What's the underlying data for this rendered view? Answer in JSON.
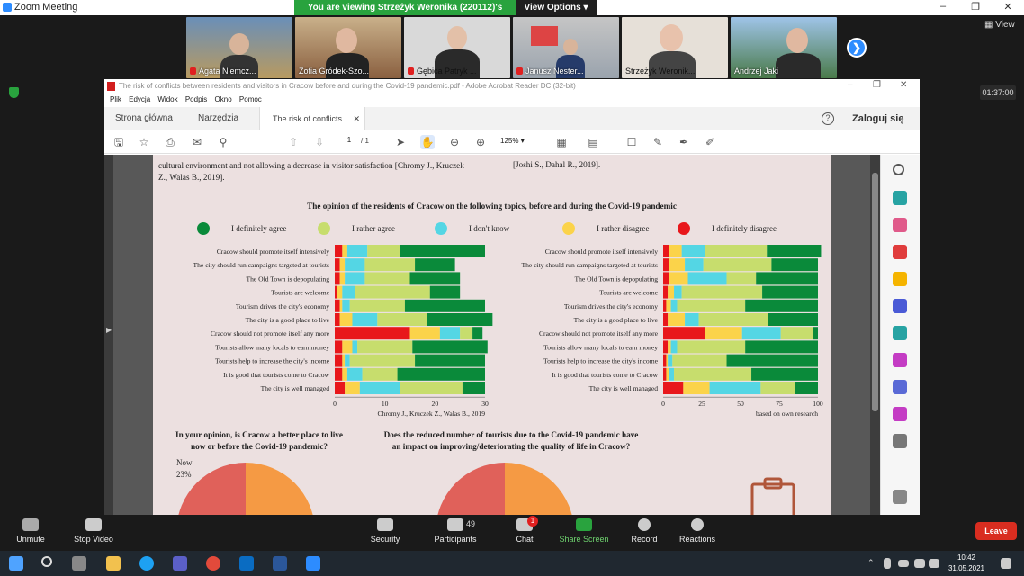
{
  "zoom": {
    "title": "Zoom Meeting",
    "share_banner": "You are viewing Strzeżyk Weronika (220112)'s screen",
    "view_options": "View Options",
    "view_label": "View",
    "timer": "01:37:00",
    "participants": [
      {
        "name": "Agata Niemcz...",
        "muted": true
      },
      {
        "name": "Zofia Gródek-Szo...",
        "muted": false
      },
      {
        "name": "Gębica Patryk ...",
        "muted": true
      },
      {
        "name": "Janusz Nester...",
        "muted": true
      },
      {
        "name": "Strzeżyk Weronik...",
        "muted": false
      },
      {
        "name": "Andrzej Jaki",
        "muted": false
      }
    ],
    "toolbar": {
      "unmute": "Unmute",
      "stop_video": "Stop Video",
      "security": "Security",
      "participants": "Participants",
      "participants_count": "49",
      "chat": "Chat",
      "chat_badge": "1",
      "share_screen": "Share Screen",
      "record": "Record",
      "reactions": "Reactions",
      "leave": "Leave"
    }
  },
  "acrobat": {
    "title": "The risk of conflicts between residents and visitors in Cracow before and during the Covid-19 pandemic.pdf - Adobe Acrobat Reader DC (32-bit)",
    "menu": [
      "Plik",
      "Edycja",
      "Widok",
      "Podpis",
      "Okno",
      "Pomoc"
    ],
    "tabs": {
      "home": "Strona główna",
      "tools": "Narzędzia",
      "doc": "The risk of conflicts ..."
    },
    "login": "Zaloguj się",
    "page_current": "1",
    "page_total": "/ 1",
    "zoom": "125%"
  },
  "pdf": {
    "left_text": [
      "cultural environment and not allowing a decrease in visitor satisfaction [Chromy J., Kruczek",
      "Z., Walas B., 2019]."
    ],
    "right_text": "[Joshi S., Dahal R., 2019].",
    "chart_title": "The opinion of the residents of Cracow on the following topics, before and during the Covid-19 pandemic",
    "left_source": "Chromy J., Kruczek Z., Walas B., 2019",
    "right_source": "based on own research",
    "q1": [
      "In your opinion, is Cracow a better place to live",
      "now or before the Covid-19 pandemic?"
    ],
    "q2": [
      "Does the reduced number of tourists due to the Covid-19 pandemic have",
      "an impact on improving/deteriorating the quality of life in Cracow?"
    ],
    "pie_label": "Now",
    "pie_value": "23%"
  },
  "chart_data": [
    {
      "type": "bar",
      "orientation": "horizontal",
      "stacked": true,
      "title": "The opinion of the residents of Cracow on the following topics, before and during the Covid-19 pandemic",
      "legend": [
        "I definitely agree",
        "I rather agree",
        "I don't know",
        "I rather disagree",
        "I definitely disagree"
      ],
      "categories": [
        "Cracow should promote itself intensively",
        "The city should run campaigns targeted at tourists",
        "The Old Town is depopulating",
        "Tourists are welcome",
        "Tourism drives the city's economy",
        "The city is a good place to live",
        "Cracow should not promote itself any more",
        "Tourists allow many locals to earn money",
        "Tourists help to increase the city's income",
        "It is good that tourists come to Cracow",
        "The city is well managed"
      ],
      "xlim": [
        0,
        30
      ],
      "xticks": [
        0,
        10,
        20,
        30
      ],
      "colors": [
        "#e8171b",
        "#fbd34a",
        "#54d6e4",
        "#c7dd6d",
        "#0a8a3a"
      ],
      "series": [
        {
          "values": [
            1.5,
            1,
            4,
            6.5,
            17
          ]
        },
        {
          "values": [
            1,
            1,
            4,
            10,
            8
          ]
        },
        {
          "values": [
            1,
            1,
            4,
            9,
            10
          ]
        },
        {
          "values": [
            0.5,
            1,
            2.5,
            15,
            6
          ]
        },
        {
          "values": [
            1,
            0.5,
            1.5,
            11,
            16
          ]
        },
        {
          "values": [
            1,
            2.5,
            5,
            10,
            13
          ]
        },
        {
          "values": [
            15,
            6,
            4,
            2.5,
            2
          ]
        },
        {
          "values": [
            1.5,
            2,
            1,
            11,
            15
          ]
        },
        {
          "values": [
            1.5,
            0.5,
            1,
            13,
            14
          ]
        },
        {
          "values": [
            1.5,
            1,
            3,
            7,
            17.5
          ]
        },
        {
          "values": [
            2,
            3,
            8,
            12.5,
            4.5
          ]
        }
      ],
      "source": "Chromy J., Kruczek Z., Walas B., 2019"
    },
    {
      "type": "bar",
      "orientation": "horizontal",
      "stacked": true,
      "legend": [
        "I definitely agree",
        "I rather agree",
        "I don't know",
        "I rather disagree",
        "I definitely disagree"
      ],
      "categories": [
        "Cracow should promote itself intensively",
        "The city should run campaigns targeted at tourists",
        "The Old Town is depopulating",
        "Tourists are welcome",
        "Tourism drives the city's economy",
        "The city is a good place to live",
        "Cracow should not promote itself any more",
        "Tourists allow many locals to earn money",
        "Tourists help to increase the city's income",
        "It is good that tourists come to Cracow",
        "The city is well managed"
      ],
      "xlim": [
        0,
        100
      ],
      "xticks": [
        0,
        25,
        50,
        75,
        100
      ],
      "colors": [
        "#e8171b",
        "#fbd34a",
        "#54d6e4",
        "#c7dd6d",
        "#0a8a3a"
      ],
      "series": [
        {
          "values": [
            4,
            8,
            15,
            40,
            35
          ]
        },
        {
          "values": [
            4,
            10,
            12,
            44,
            30
          ]
        },
        {
          "values": [
            4,
            12,
            25,
            19,
            40
          ]
        },
        {
          "values": [
            3,
            4,
            5,
            52,
            36
          ]
        },
        {
          "values": [
            2,
            3,
            4,
            44,
            47
          ]
        },
        {
          "values": [
            3,
            11,
            9,
            45,
            32
          ]
        },
        {
          "values": [
            27,
            24,
            25,
            21,
            3
          ]
        },
        {
          "values": [
            3,
            2,
            4,
            44,
            47
          ]
        },
        {
          "values": [
            2,
            1,
            3,
            35,
            59
          ]
        },
        {
          "values": [
            2,
            2,
            3,
            50,
            43
          ]
        },
        {
          "values": [
            13,
            17,
            33,
            22,
            15
          ]
        }
      ],
      "source": "based on own research"
    }
  ],
  "taskbar": {
    "time": "10:42",
    "date": "31.05.2021"
  }
}
